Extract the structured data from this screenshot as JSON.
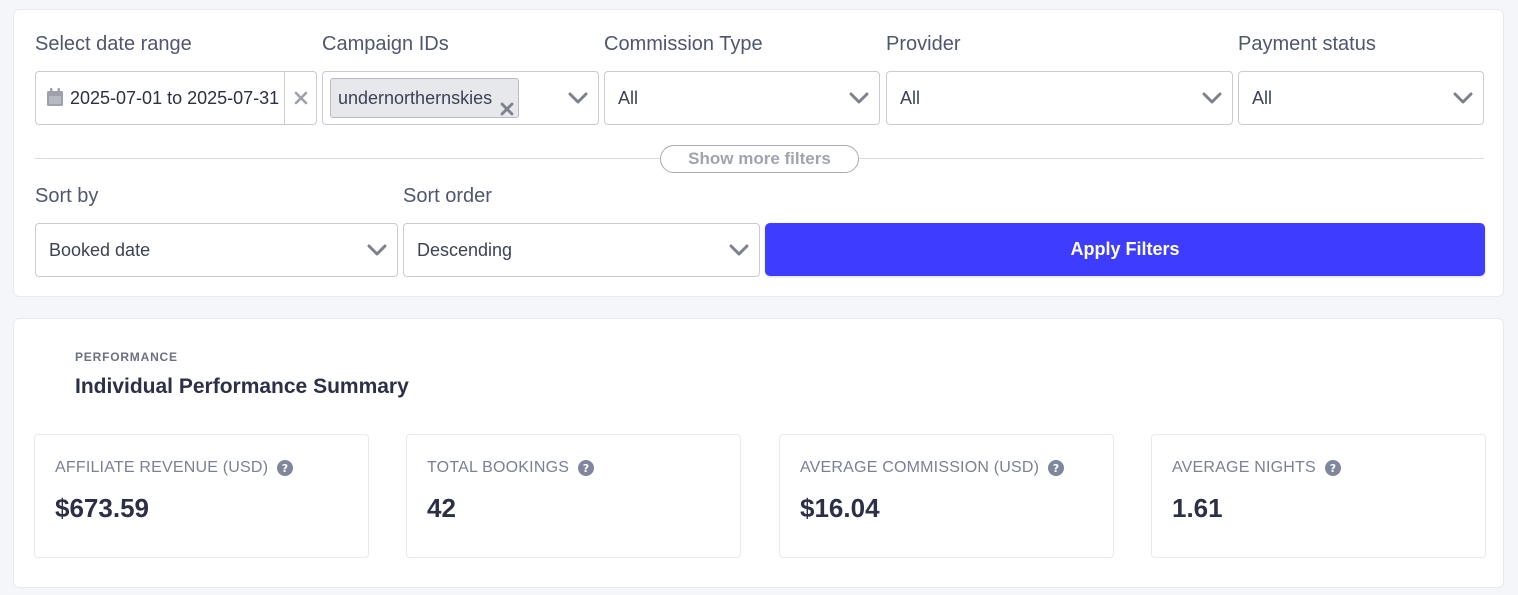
{
  "filters": {
    "date_range": {
      "label": "Select date range",
      "value": "2025-07-01 to 2025-07-31"
    },
    "campaign_ids": {
      "label": "Campaign IDs",
      "tags": [
        "undernorthernskies"
      ]
    },
    "commission_type": {
      "label": "Commission Type",
      "value": "All"
    },
    "provider": {
      "label": "Provider",
      "value": "All"
    },
    "payment_status": {
      "label": "Payment status",
      "value": "All"
    },
    "show_more_label": "Show more filters",
    "sort_by": {
      "label": "Sort by",
      "value": "Booked date"
    },
    "sort_order": {
      "label": "Sort order",
      "value": "Descending"
    },
    "apply_label": "Apply Filters"
  },
  "performance": {
    "eyebrow": "PERFORMANCE",
    "title": "Individual Performance Summary",
    "metrics": [
      {
        "label": "AFFILIATE REVENUE (USD)",
        "value": "$673.59"
      },
      {
        "label": "TOTAL BOOKINGS",
        "value": "42"
      },
      {
        "label": "AVERAGE COMMISSION (USD)",
        "value": "$16.04"
      },
      {
        "label": "AVERAGE NIGHTS",
        "value": "1.61"
      }
    ]
  },
  "colors": {
    "accent": "#3d3cff",
    "page_bg": "#f5f6fa",
    "text_dark": "#2c3047",
    "text_muted": "#7a8098"
  },
  "icons": {
    "date": "calendar-icon",
    "clear": "close-icon",
    "dropdown": "chevron-down-icon",
    "help": "question-circle-icon"
  }
}
